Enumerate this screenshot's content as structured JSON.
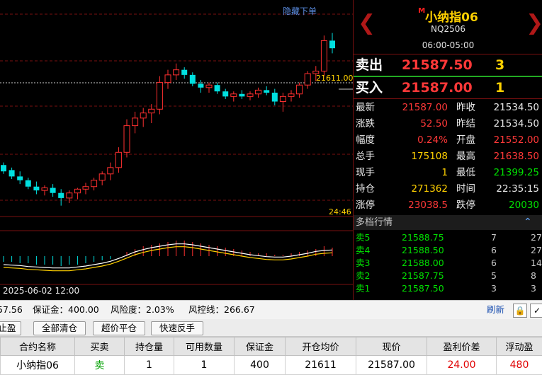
{
  "chart": {
    "hide_orders_label": "隐藏下单",
    "price_line_label": "21611.00",
    "time_label": "24:46",
    "date_label": "2025-06-02 12:00",
    "colors": {
      "up": "#ff3030",
      "down": "#00e0e0",
      "ma1": "#ffffff",
      "ma2": "#ffd000",
      "grid": "#7a1010"
    }
  },
  "chart_data": {
    "type": "candlestick",
    "candles": [
      {
        "o": 21538,
        "h": 21540,
        "l": 21531,
        "c": 21533
      },
      {
        "o": 21534,
        "h": 21536,
        "l": 21527,
        "c": 21529
      },
      {
        "o": 21529,
        "h": 21533,
        "l": 21523,
        "c": 21526
      },
      {
        "o": 21526,
        "h": 21528,
        "l": 21519,
        "c": 21521
      },
      {
        "o": 21521,
        "h": 21525,
        "l": 21515,
        "c": 21518
      },
      {
        "o": 21518,
        "h": 21522,
        "l": 21514,
        "c": 21520
      },
      {
        "o": 21520,
        "h": 21523,
        "l": 21513,
        "c": 21516
      },
      {
        "o": 21516,
        "h": 21519,
        "l": 21506,
        "c": 21512
      },
      {
        "o": 21512,
        "h": 21518,
        "l": 21508,
        "c": 21516
      },
      {
        "o": 21516,
        "h": 21520,
        "l": 21511,
        "c": 21519
      },
      {
        "o": 21519,
        "h": 21524,
        "l": 21515,
        "c": 21521
      },
      {
        "o": 21521,
        "h": 21528,
        "l": 21518,
        "c": 21526
      },
      {
        "o": 21526,
        "h": 21533,
        "l": 21522,
        "c": 21531
      },
      {
        "o": 21531,
        "h": 21540,
        "l": 21526,
        "c": 21536
      },
      {
        "o": 21536,
        "h": 21552,
        "l": 21532,
        "c": 21548
      },
      {
        "o": 21548,
        "h": 21574,
        "l": 21544,
        "c": 21569
      },
      {
        "o": 21569,
        "h": 21580,
        "l": 21563,
        "c": 21575
      },
      {
        "o": 21575,
        "h": 21583,
        "l": 21568,
        "c": 21579
      },
      {
        "o": 21579,
        "h": 21586,
        "l": 21571,
        "c": 21582
      },
      {
        "o": 21582,
        "h": 21608,
        "l": 21578,
        "c": 21603
      },
      {
        "o": 21603,
        "h": 21613,
        "l": 21598,
        "c": 21609
      },
      {
        "o": 21609,
        "h": 21618,
        "l": 21605,
        "c": 21613
      },
      {
        "o": 21613,
        "h": 21615,
        "l": 21606,
        "c": 21609
      },
      {
        "o": 21609,
        "h": 21611,
        "l": 21600,
        "c": 21602
      },
      {
        "o": 21602,
        "h": 21605,
        "l": 21595,
        "c": 21599
      },
      {
        "o": 21599,
        "h": 21603,
        "l": 21595,
        "c": 21601
      },
      {
        "o": 21601,
        "h": 21603,
        "l": 21594,
        "c": 21596
      },
      {
        "o": 21596,
        "h": 21598,
        "l": 21590,
        "c": 21592
      },
      {
        "o": 21592,
        "h": 21596,
        "l": 21588,
        "c": 21594
      },
      {
        "o": 21594,
        "h": 21597,
        "l": 21590,
        "c": 21592
      },
      {
        "o": 21592,
        "h": 21596,
        "l": 21589,
        "c": 21594
      },
      {
        "o": 21594,
        "h": 21599,
        "l": 21591,
        "c": 21597
      },
      {
        "o": 21597,
        "h": 21600,
        "l": 21593,
        "c": 21595
      },
      {
        "o": 21595,
        "h": 21598,
        "l": 21585,
        "c": 21588
      },
      {
        "o": 21588,
        "h": 21595,
        "l": 21580,
        "c": 21592
      },
      {
        "o": 21592,
        "h": 21597,
        "l": 21588,
        "c": 21594
      },
      {
        "o": 21594,
        "h": 21603,
        "l": 21591,
        "c": 21601
      },
      {
        "o": 21601,
        "h": 21612,
        "l": 21598,
        "c": 21610
      },
      {
        "o": 21610,
        "h": 21616,
        "l": 21604,
        "c": 21612
      },
      {
        "o": 21612,
        "h": 21640,
        "l": 21608,
        "c": 21636
      },
      {
        "o": 21636,
        "h": 21642,
        "l": 21626,
        "c": 21630
      }
    ],
    "macd": [
      -4,
      -4,
      -5,
      -5,
      -6,
      -6,
      -6,
      -7,
      -6,
      -6,
      -5,
      -4,
      -3,
      -2,
      0,
      3,
      5,
      7,
      8,
      9,
      10,
      11,
      11,
      10,
      9,
      8,
      7,
      6,
      5,
      4,
      3,
      2,
      2,
      1,
      1,
      2,
      3,
      4,
      5,
      7,
      6
    ],
    "price_range": [
      21498,
      21668
    ]
  },
  "quote": {
    "name": "小纳指06",
    "mark": "M",
    "code": "NQ2506",
    "session": "06:00-05:00",
    "sell": {
      "label": "卖出",
      "price": "21587.50",
      "qty": "3"
    },
    "buy": {
      "label": "买入",
      "price": "21587.00",
      "qty": "1"
    },
    "rows": [
      {
        "k1": "最新",
        "v1": "21587.00",
        "c1": "red",
        "k2": "昨收",
        "v2": "21534.50",
        "c2": "white"
      },
      {
        "k1": "涨跌",
        "v1": "52.50",
        "c1": "red",
        "k2": "昨结",
        "v2": "21534.50",
        "c2": "white"
      },
      {
        "k1": "幅度",
        "v1": "0.24%",
        "c1": "red",
        "k2": "开盘",
        "v2": "21552.00",
        "c2": "red"
      },
      {
        "k1": "总手",
        "v1": "175108",
        "c1": "yellow",
        "k2": "最高",
        "v2": "21638.50",
        "c2": "red"
      },
      {
        "k1": "现手",
        "v1": "1",
        "c1": "yellow",
        "k2": "最低",
        "v2": "21399.25",
        "c2": "green"
      },
      {
        "k1": "持仓",
        "v1": "271362",
        "c1": "yellow",
        "k2": "时间",
        "v2": "22:35:15",
        "c2": "white"
      },
      {
        "k1": "涨停",
        "v1": "23038.5",
        "c1": "red",
        "k2": "跌停",
        "v2": "20030",
        "c2": "green"
      }
    ],
    "depth_title": "多档行情",
    "depth": [
      {
        "label": "卖5",
        "price": "21588.75",
        "vol": "7",
        "total": "27"
      },
      {
        "label": "卖4",
        "price": "21588.50",
        "vol": "6",
        "total": "27"
      },
      {
        "label": "卖3",
        "price": "21588.00",
        "vol": "6",
        "total": "14"
      },
      {
        "label": "卖2",
        "price": "21587.75",
        "vol": "5",
        "total": "8"
      },
      {
        "label": "卖1",
        "price": "21587.50",
        "vol": "3",
        "total": "3"
      }
    ]
  },
  "status": {
    "left_value": "57.56",
    "margin": "保证金：400.00",
    "risk": "风险度：2.03%",
    "risk_line": "风控线：266.67",
    "refresh": "刷新"
  },
  "buttons": {
    "stop_profit": "止盈",
    "close_all": "全部清仓",
    "super_close": "超价平仓",
    "reverse": "快速反手"
  },
  "table": {
    "headers": [
      "合约名称",
      "买卖",
      "持仓量",
      "可用数量",
      "保证金",
      "开仓均价",
      "现价",
      "盈利价差",
      "浮动盈"
    ],
    "row": [
      "小纳指06",
      "卖",
      "1",
      "1",
      "400",
      "21611",
      "21587.00",
      "24.00",
      "480"
    ]
  }
}
